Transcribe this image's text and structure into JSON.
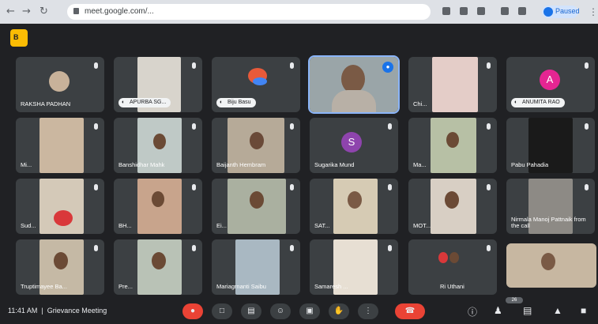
{
  "browser": {
    "url": "meet.google.com/...",
    "paused_label": "Paused"
  },
  "meet": {
    "app_badge": "B",
    "participants": [
      {
        "name": "RAKSHA PADHAN",
        "type": "avatar"
      },
      {
        "name": "APURBA SG...",
        "type": "pill"
      },
      {
        "name": "Biju Basu",
        "type": "pill"
      },
      {
        "name": "",
        "type": "video",
        "speaking": true
      },
      {
        "name": "Chi...",
        "type": "video"
      },
      {
        "name": "ANUMITA RAO",
        "type": "pill",
        "avatar_letter": "A"
      },
      {
        "name": "Mi...",
        "type": "video"
      },
      {
        "name": "Banshidhar Mahk",
        "type": "video"
      },
      {
        "name": "Baijanth Hembram",
        "type": "video"
      },
      {
        "name": "Sugarika Mund",
        "type": "avatar",
        "avatar_letter": "S"
      },
      {
        "name": "Ma...",
        "type": "video"
      },
      {
        "name": "Pabu Pahadia",
        "type": "video"
      },
      {
        "name": "Sud...",
        "type": "video"
      },
      {
        "name": "BH...",
        "type": "video"
      },
      {
        "name": "Ei...",
        "type": "video"
      },
      {
        "name": "SAT...",
        "type": "video"
      },
      {
        "name": "MOT...",
        "type": "video"
      },
      {
        "name": "Nirmala Manoj Pattnaik from the call",
        "type": "video"
      },
      {
        "name": "Truptimayee Ba...",
        "type": "video"
      },
      {
        "name": "Pre...",
        "type": "video"
      },
      {
        "name": "Mariagrnanti Saibu",
        "type": "video"
      },
      {
        "name": "Samaresh ...",
        "type": "video"
      },
      {
        "name": "Ri Uthani",
        "type": "video"
      },
      {
        "name": "",
        "type": "video"
      }
    ]
  },
  "bottom_bar": {
    "time": "11:41 AM",
    "separator": "|",
    "meeting_name": "Grievance Meeting",
    "participant_count": "26"
  },
  "colors": {
    "background": "#202124",
    "tile": "#3c4043",
    "accent_blue": "#1a73e8",
    "end_call_red": "#ea4335",
    "meet_yellow": "#fbbc04"
  }
}
